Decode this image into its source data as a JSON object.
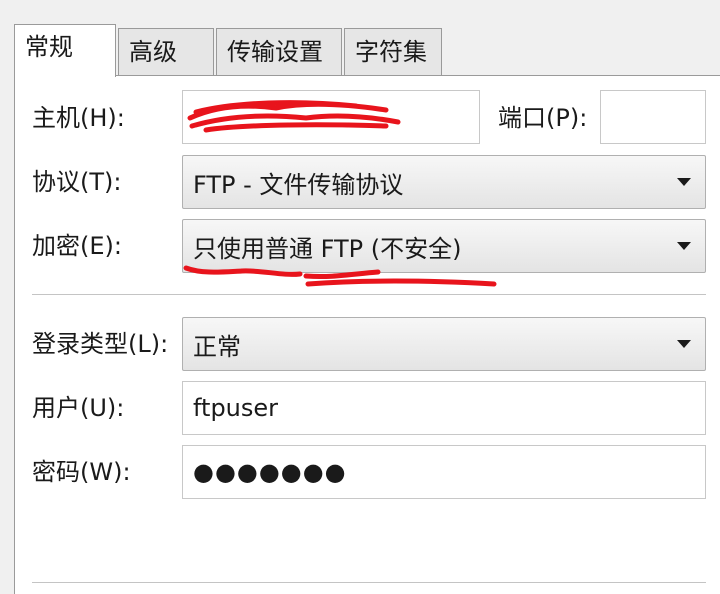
{
  "tabs": [
    {
      "label": "常规",
      "active": true
    },
    {
      "label": "高级",
      "active": false
    },
    {
      "label": "传输设置",
      "active": false
    },
    {
      "label": "字符集",
      "active": false
    }
  ],
  "host": {
    "label": "主机(H):",
    "value": ""
  },
  "port": {
    "label": "端口(P):",
    "value": ""
  },
  "protocol": {
    "label": "协议(T):",
    "selected": "FTP - 文件传输协议"
  },
  "encryption": {
    "label": "加密(E):",
    "selected": "只使用普通 FTP (不安全)"
  },
  "login_type": {
    "label": "登录类型(L):",
    "selected": "正常"
  },
  "user": {
    "label": "用户(U):",
    "value": "ftpuser"
  },
  "password": {
    "label": "密码(W):",
    "value": "●●●●●●●"
  },
  "colors": {
    "annotation": "#e8141c",
    "panel": "#ffffff",
    "background": "#f0f0f0"
  }
}
